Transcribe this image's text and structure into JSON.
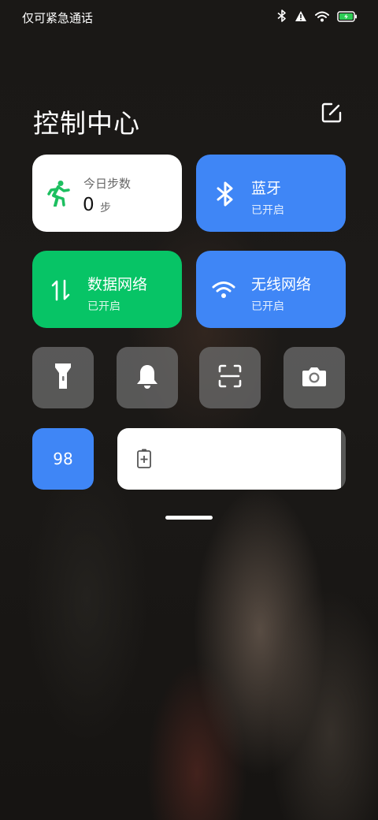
{
  "status_bar": {
    "carrier_text": "仅可紧急通话",
    "icons": [
      "bluetooth-icon",
      "alert-icon",
      "wifi-icon",
      "battery-charging-icon"
    ]
  },
  "header": {
    "title": "控制中心",
    "edit_icon": "edit-icon"
  },
  "tiles": {
    "steps": {
      "label": "今日步数",
      "value": "0",
      "unit": "步",
      "icon": "running-person-icon",
      "icon_color": "#1dbf60"
    },
    "bluetooth": {
      "label": "蓝牙",
      "status": "已开启",
      "icon": "bluetooth-icon",
      "color": "#3f86f6"
    },
    "mobile_data": {
      "label": "数据网络",
      "status": "已开启",
      "icon": "data-transfer-icon",
      "color": "#07c466"
    },
    "wifi": {
      "label": "无线网络",
      "status": "已开启",
      "icon": "wifi-icon",
      "color": "#3f86f6"
    }
  },
  "quick_toggles": [
    "flashlight-icon",
    "bell-icon",
    "scan-icon",
    "camera-icon"
  ],
  "brightness": {
    "value": "98",
    "color": "#3f86f6"
  },
  "battery_saver": {
    "icon": "battery-plus-icon",
    "level": 0.98
  }
}
